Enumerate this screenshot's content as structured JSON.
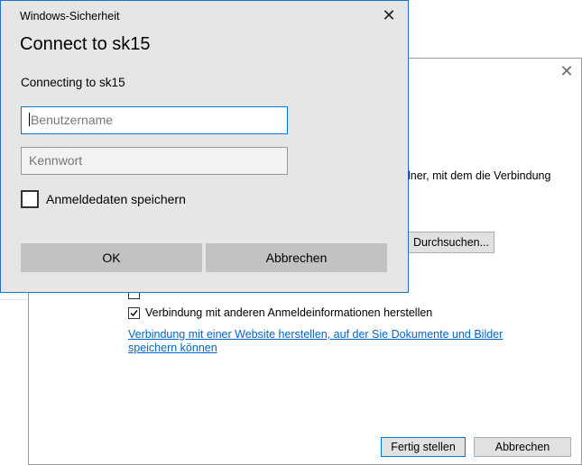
{
  "wizard": {
    "description_tail": "lner, mit dem die Verbindung",
    "browse_label": "Durchsuchen...",
    "checkbox_label": "Verbindung mit anderen Anmeldeinformationen herstellen",
    "checkbox_checked": true,
    "link_text": "Verbindung mit einer Website herstellen, auf der Sie Dokumente und Bilder speichern können",
    "finish_label": "Fertig stellen",
    "cancel_label": "Abbrechen"
  },
  "credential_dialog": {
    "window_title": "Windows-Sicherheit",
    "heading": "Connect to sk15",
    "subheading": "Connecting to sk15",
    "username": {
      "value": "",
      "placeholder": "Benutzername"
    },
    "password": {
      "value": "",
      "placeholder": "Kennwort"
    },
    "save_credentials_label": "Anmeldedaten speichern",
    "save_credentials_checked": false,
    "ok_label": "OK",
    "cancel_label": "Abbrechen"
  },
  "colors": {
    "accent": "#0078d7",
    "dialog_bg": "#e6e6e6",
    "button_bg": "#c2c2c2",
    "link": "#0066cc"
  }
}
